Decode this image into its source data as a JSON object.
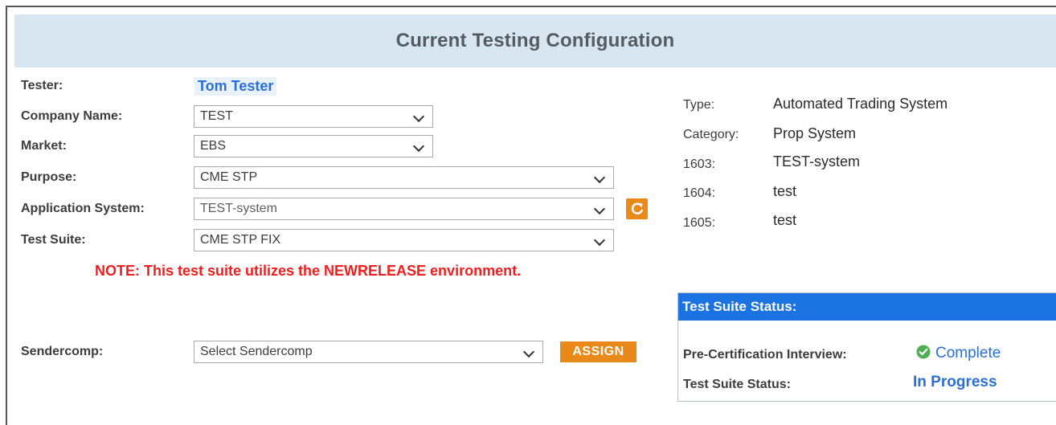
{
  "header": {
    "title": "Current Testing Configuration"
  },
  "form": {
    "tester_label": "Tester:",
    "tester_name": "Tom Tester",
    "company_label": "Company Name:",
    "company_value": "TEST",
    "market_label": "Market:",
    "market_value": "EBS",
    "purpose_label": "Purpose:",
    "purpose_value": "CME STP",
    "app_system_label": "Application System:",
    "app_system_value": "TEST-system",
    "test_suite_label": "Test Suite:",
    "test_suite_value": "CME STP FIX",
    "note": "NOTE: This test suite utilizes the NEWRELEASE environment.",
    "sendercomp_label": "Sendercomp:",
    "sendercomp_placeholder": "Select Sendercomp",
    "assign_label": "ASSIGN"
  },
  "info": {
    "type_label": "Type:",
    "type_value": "Automated Trading System",
    "category_label": "Category:",
    "category_value": "Prop System",
    "f1603_label": "1603:",
    "f1603_value": "TEST-system",
    "f1604_label": "1604:",
    "f1604_value": "test",
    "f1605_label": "1605:",
    "f1605_value": "test"
  },
  "status": {
    "title": "Test Suite Status:",
    "interview_label": "Pre-Certification Interview:",
    "interview_value": "Complete",
    "suite_label": "Test Suite Status:",
    "suite_value": "In Progress"
  },
  "colors": {
    "accent_orange": "#e8891a",
    "status_blue": "#1a73e0",
    "link_blue": "#2a6fd6",
    "note_red": "#f01e1e",
    "header_bg": "#d7e6f0",
    "check_green": "#4caf50"
  },
  "icons": {
    "refresh": "refresh-icon",
    "check": "check-circle-icon",
    "dropdown": "chevron-down-icon"
  }
}
